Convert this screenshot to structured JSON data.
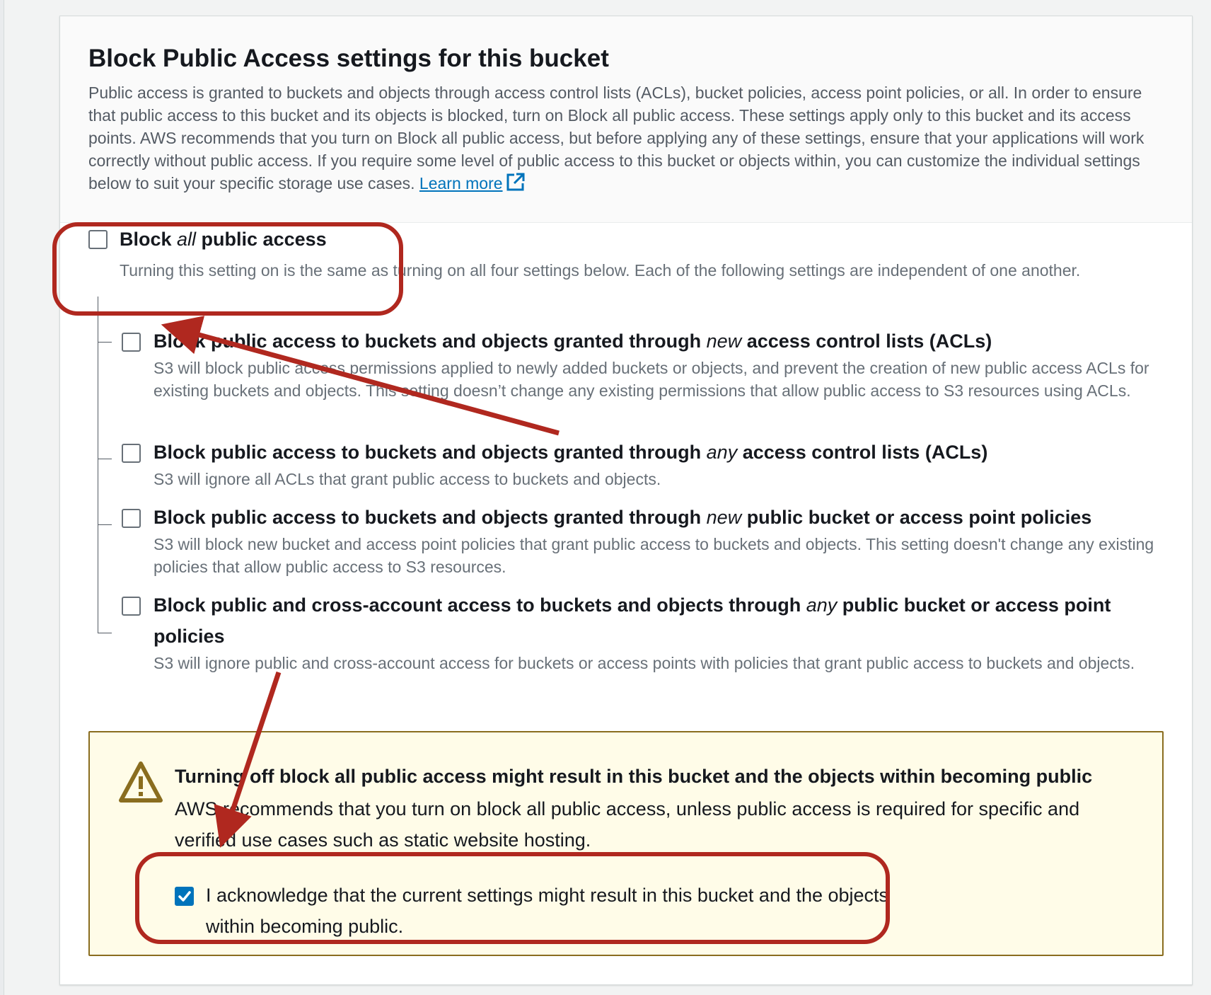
{
  "panel": {
    "title": "Block Public Access settings for this bucket",
    "description": "Public access is granted to buckets and objects through access control lists (ACLs), bucket policies, access point policies, or all. In order to ensure that public access to this bucket and its objects is blocked, turn on Block all public access. These settings apply only to this bucket and its access points. AWS recommends that you turn on Block all public access, but before applying any of these settings, ensure that your applications will work correctly without public access. If you require some level of public access to this bucket or objects within, you can customize the individual settings below to suit your specific storage use cases.",
    "learn_more": "Learn more"
  },
  "block_all": {
    "label_pre": "Block ",
    "label_em": "all",
    "label_post": " public access",
    "description": "Turning this setting on is the same as turning on all four settings below. Each of the following settings are independent of one another.",
    "checked": false
  },
  "options": [
    {
      "label_pre": "Block public access to buckets and objects granted through ",
      "label_em": "new",
      "label_post": " access control lists (ACLs)",
      "description": "S3 will block public access permissions applied to newly added buckets or objects, and prevent the creation of new public access ACLs for existing buckets and objects. This setting doesn’t change any existing permissions that allow public access to S3 resources using ACLs.",
      "checked": false
    },
    {
      "label_pre": "Block public access to buckets and objects granted through ",
      "label_em": "any",
      "label_post": " access control lists (ACLs)",
      "description": "S3 will ignore all ACLs that grant public access to buckets and objects.",
      "checked": false
    },
    {
      "label_pre": "Block public access to buckets and objects granted through ",
      "label_em": "new",
      "label_post": " public bucket or access point policies",
      "description": "S3 will block new bucket and access point policies that grant public access to buckets and objects. This setting doesn't change any existing policies that allow public access to S3 resources.",
      "checked": false
    },
    {
      "label_pre": "Block public and cross-account access to buckets and objects through ",
      "label_em": "any",
      "label_post": " public bucket or access point policies",
      "description": "S3 will ignore public and cross-account access for buckets or access points with policies that grant public access to buckets and objects.",
      "checked": false
    }
  ],
  "warning": {
    "title": "Turning off block all public access might result in this bucket and the objects within becoming public",
    "description": "AWS recommends that you turn on block all public access, unless public access is required for specific and verified use cases such as static website hosting.",
    "ack_label": "I acknowledge that the current settings might result in this bucket and the objects within becoming public.",
    "ack_checked": true
  },
  "colors": {
    "annotation": "#b0281f",
    "checkbox_checked": "#0073bb",
    "warning_bg": "#fffce8",
    "warning_border": "#8a6d1f",
    "link": "#0073bb"
  }
}
